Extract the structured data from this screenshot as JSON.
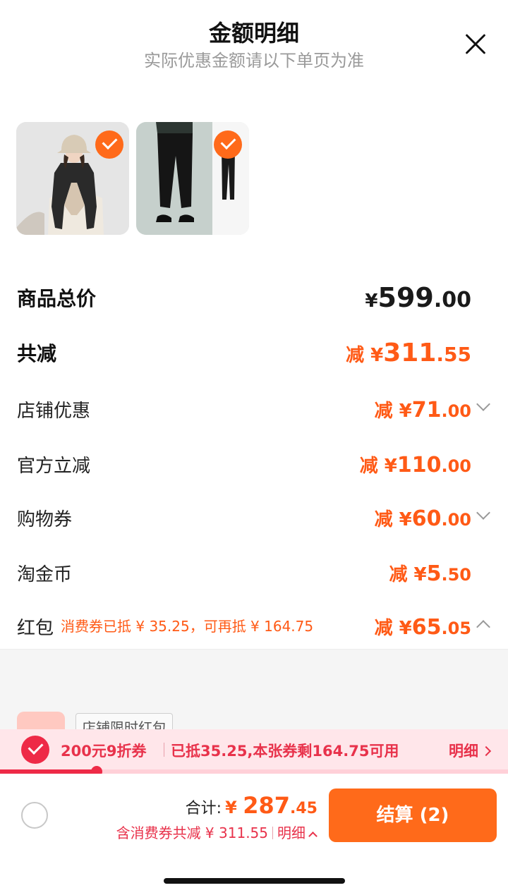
{
  "header": {
    "title": "金额明细",
    "subtitle": "实际优惠金额请以下单页为准"
  },
  "products": [
    {
      "name": "product-vest-image",
      "selected": true
    },
    {
      "name": "product-pants-image",
      "selected": true
    }
  ],
  "summary": {
    "total": {
      "label": "商品总价",
      "currency": "¥",
      "int": "599",
      "dec": ".00"
    },
    "reduce": {
      "label": "共减",
      "prefix": "减",
      "currency": "¥",
      "int": "311",
      "dec": ".55"
    }
  },
  "discounts": [
    {
      "label": "店铺优惠",
      "prefix": "减",
      "currency": "¥",
      "int": "71",
      "dec": ".00",
      "expand": "down"
    },
    {
      "label": "官方立减",
      "prefix": "减",
      "currency": "¥",
      "int": "110",
      "dec": ".00",
      "expand": "none"
    },
    {
      "label": "购物券",
      "prefix": "减",
      "currency": "¥",
      "int": "60",
      "dec": ".00",
      "expand": "down"
    },
    {
      "label": "淘金币",
      "prefix": "减",
      "currency": "¥",
      "int": "5",
      "dec": ".50",
      "expand": "none"
    },
    {
      "label": "红包",
      "note": "消费券已抵 ¥ 35.25，可再抵 ¥ 164.75",
      "prefix": "减",
      "currency": "¥",
      "int": "65",
      "dec": ".05",
      "expand": "up"
    }
  ],
  "redpacket_detail": {
    "tag": "店铺限时红包"
  },
  "coupon_bar": {
    "name": "200元9折券",
    "info": "已抵35.25,本张券剩164.75可用",
    "detail": "明细",
    "progress": 0.19,
    "accent": "#ee2a47"
  },
  "footer": {
    "sum_label": "合计:",
    "currency": "¥",
    "int": "287",
    "dec": ".45",
    "sub_text": "含消费券共减 ¥ 311.55",
    "sub_detail": "明细",
    "checkout": "结算 (2)",
    "checkout_color": "#ff6a1a"
  }
}
